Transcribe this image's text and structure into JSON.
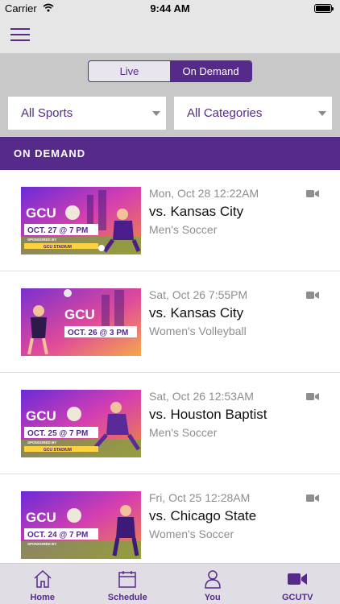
{
  "status_bar": {
    "carrier": "Carrier",
    "time": "9:44 AM"
  },
  "segmented": {
    "live": "Live",
    "on_demand": "On Demand",
    "selected": "On Demand"
  },
  "filters": {
    "sports": "All Sports",
    "categories": "All Categories"
  },
  "section_title": "ON DEMAND",
  "thumbnail_graphics": [
    {
      "brand": "GCU",
      "date": "OCT. 27 @ 7 PM",
      "sponsor": "SPONSORED BY",
      "venue": "GCU STADIUM"
    },
    {
      "brand": "GCU",
      "date": "OCT. 26 @ 3 PM"
    },
    {
      "brand": "GCU",
      "date": "OCT. 25 @ 7 PM",
      "sponsor": "SPONSORED BY",
      "venue": "GCU STADIUM"
    },
    {
      "brand": "GCU",
      "date": "OCT. 24 @ 7 PM",
      "sponsor": "SPONSORED BY"
    }
  ],
  "events": [
    {
      "date": "Mon, Oct 28 12:22AM",
      "title": "vs. Kansas City",
      "sport": "Men's Soccer",
      "media_icon": "video-camera-icon"
    },
    {
      "date": "Sat, Oct 26 7:55PM",
      "title": "vs. Kansas City",
      "sport": "Women's Volleyball",
      "media_icon": "video-camera-icon"
    },
    {
      "date": "Sat, Oct 26 12:53AM",
      "title": "vs. Houston Baptist",
      "sport": "Men's Soccer",
      "media_icon": "video-camera-icon"
    },
    {
      "date": "Fri, Oct 25 12:28AM",
      "title": "vs. Chicago State",
      "sport": "Women's Soccer",
      "media_icon": "video-camera-icon"
    }
  ],
  "tabs": [
    {
      "label": "Home",
      "icon": "home-icon"
    },
    {
      "label": "Schedule",
      "icon": "calendar-icon"
    },
    {
      "label": "You",
      "icon": "person-icon"
    },
    {
      "label": "GCUTV",
      "icon": "video-camera-icon",
      "active": true
    }
  ],
  "colors": {
    "brand_purple": "#552a8a",
    "muted_text": "#8e8e8e",
    "thumbnail_gold": "#ffd23f"
  }
}
